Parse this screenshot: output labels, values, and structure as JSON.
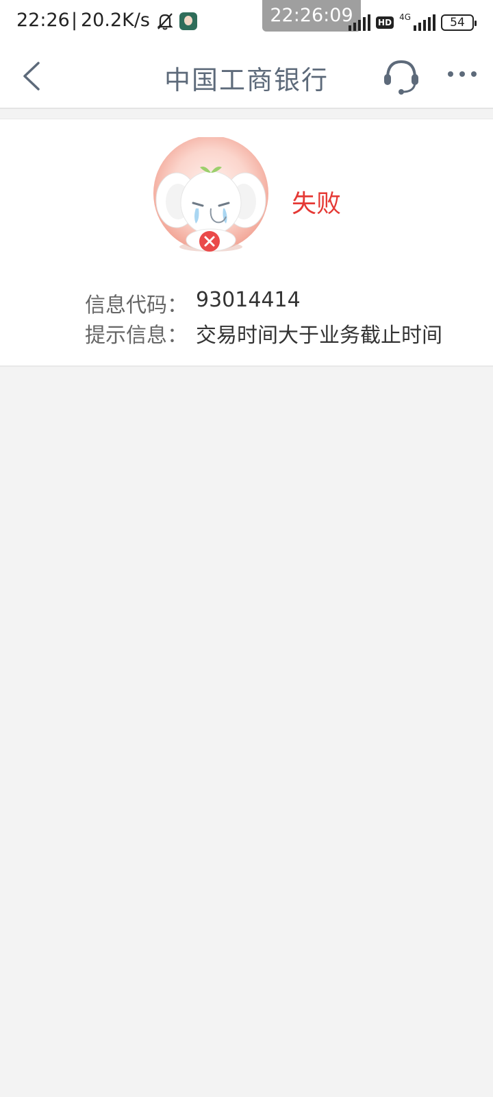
{
  "status_bar": {
    "time": "22:26",
    "separator": "|",
    "speed": "20.2K/s",
    "overlay_time": "22:26:09",
    "hd_label": "HD",
    "net_label": "4G",
    "battery": "54"
  },
  "nav": {
    "title": "中国工商银行",
    "back_icon": "chevron-left-icon",
    "service_icon": "headset-icon",
    "more_icon": "more-icon"
  },
  "result": {
    "status": "失败",
    "status_color": "#e53935",
    "code_label": "信息代码：",
    "code_value": "93014414",
    "message_label": "提示信息：",
    "message_value": "交易时间大于业务截止时间"
  }
}
